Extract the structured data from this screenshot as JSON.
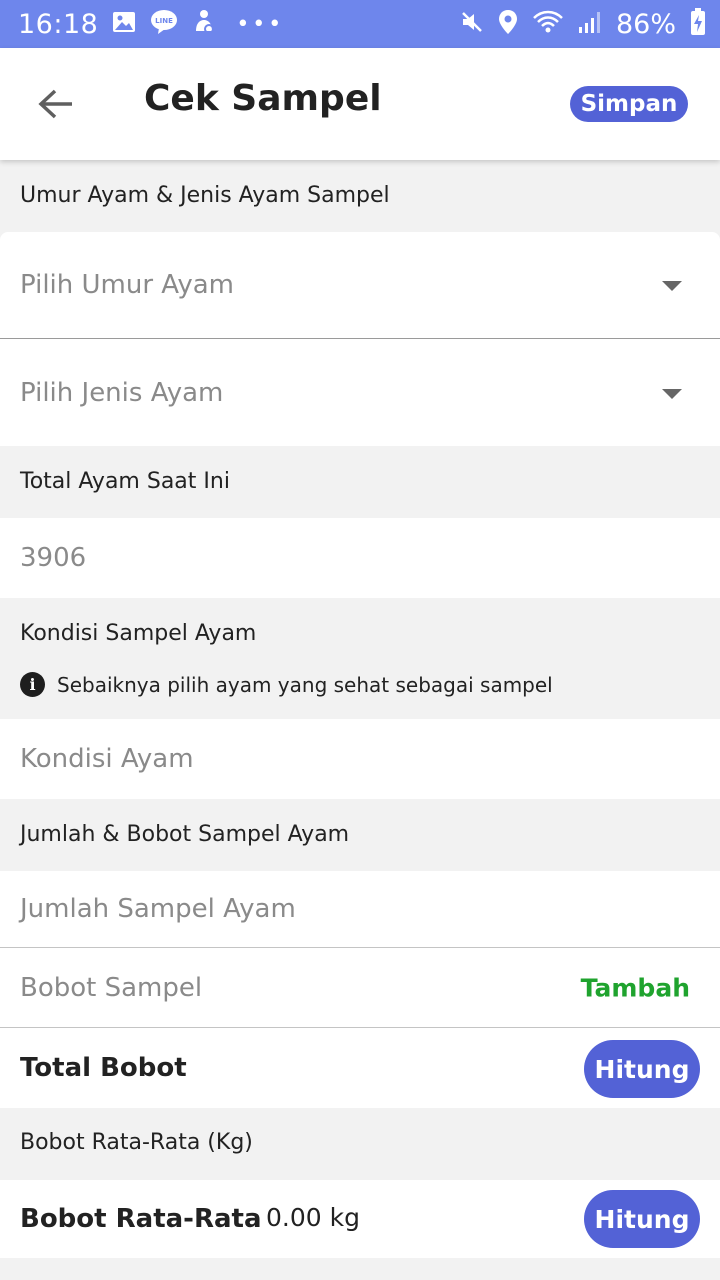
{
  "status_bar": {
    "time": "16:18",
    "battery": "86%",
    "icons_left": [
      "gallery-icon",
      "line-app-icon",
      "accessibility-icon",
      "more-dots-icon"
    ],
    "icons_right": [
      "mute-icon",
      "location-icon",
      "wifi-icon",
      "signal-icon",
      "battery-charging-icon"
    ],
    "color": "#6e86ec"
  },
  "app_bar": {
    "title": "Cek Sampel",
    "save_label": "Simpan"
  },
  "sections": {
    "umur_jenis_label": "Umur Ayam & Jenis Ayam Sampel",
    "umur_placeholder": "Pilih Umur Ayam",
    "jenis_placeholder": "Pilih Jenis Ayam",
    "total_ayam_label": "Total Ayam Saat Ini",
    "total_ayam_value": "3906",
    "kondisi_label": "Kondisi Sampel Ayam",
    "kondisi_info": "Sebaiknya pilih ayam yang sehat sebagai sampel",
    "kondisi_placeholder": "Kondisi Ayam",
    "jumlah_bobot_label": "Jumlah & Bobot Sampel Ayam",
    "jumlah_placeholder": "Jumlah Sampel Ayam",
    "bobot_placeholder": "Bobot Sampel",
    "tambah_label": "Tambah",
    "total_bobot_label": "Total Bobot",
    "hitung_label": "Hitung",
    "rata_section_label": "Bobot Rata-Rata (Kg)",
    "rata_label": "Bobot Rata-Rata",
    "rata_value": "0.00 kg",
    "hitung_label_2": "Hitung"
  },
  "colors": {
    "accent": "#5362d6",
    "tambah": "#1fa32e"
  }
}
